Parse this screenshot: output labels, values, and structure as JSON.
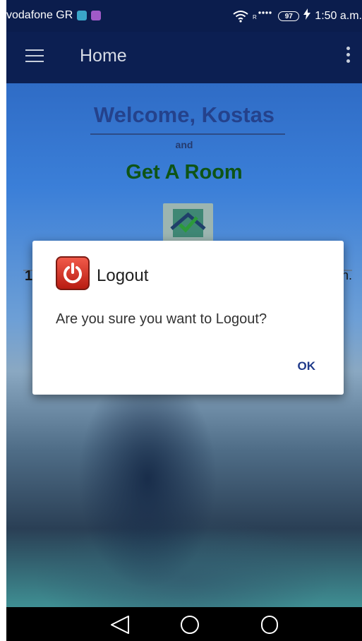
{
  "status_bar": {
    "carrier": "vodafone GR",
    "battery": "97",
    "time": "1:50 a.m."
  },
  "app_bar": {
    "title": "Home"
  },
  "background": {
    "welcome": "Welcome, Kostas",
    "and": "and",
    "app_name": "Get A Room",
    "left_fragment": "1",
    "right_fragment": "n."
  },
  "dialog": {
    "title": "Logout",
    "message": "Are you sure you want to Logout?",
    "ok_label": "OK"
  },
  "nav_bar": {
    "buttons": [
      "back-icon",
      "home-icon",
      "recents-icon"
    ]
  },
  "colors": {
    "app_bar": "#0c1f52",
    "accent": "#1f3a8a",
    "dialog_icon": "#d9322a"
  }
}
